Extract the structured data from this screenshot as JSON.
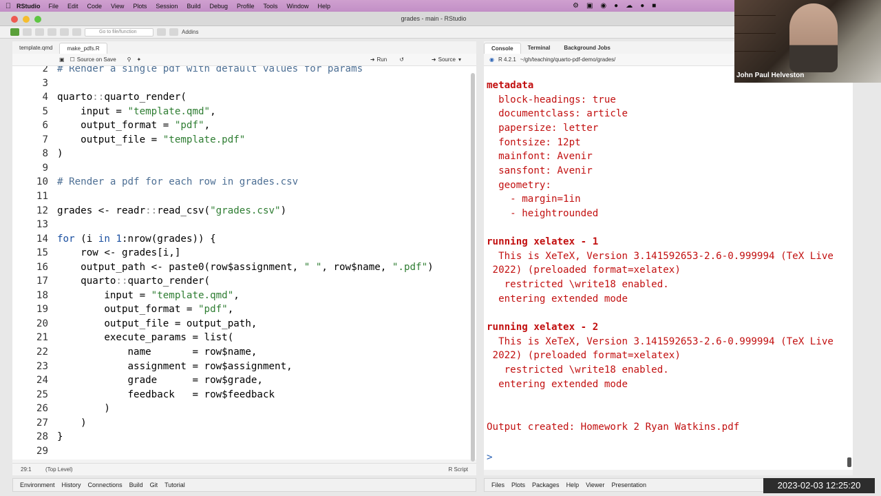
{
  "menubar": {
    "app": "RStudio",
    "items": [
      "File",
      "Edit",
      "Code",
      "View",
      "Plots",
      "Session",
      "Build",
      "Debug",
      "Profile",
      "Tools",
      "Window",
      "Help"
    ]
  },
  "window": {
    "title": "grades - main - RStudio"
  },
  "toolbar": {
    "goto_placeholder": "Go to file/function",
    "addins": "Addins"
  },
  "editor": {
    "tabs": [
      "template.qmd",
      "make_pdfs.R"
    ],
    "source_on_save": "Source on Save",
    "run": "Run",
    "source": "Source",
    "status_pos": "29:1",
    "status_scope": "(Top Level)",
    "status_type": "R Script"
  },
  "code_lines": [
    {
      "n": "2",
      "t": "# Render a single pdf with default values for params"
    },
    {
      "n": "3",
      "t": ""
    },
    {
      "n": "4",
      "t": "quarto::quarto_render("
    },
    {
      "n": "5",
      "t": "    input = \"template.qmd\","
    },
    {
      "n": "6",
      "t": "    output_format = \"pdf\","
    },
    {
      "n": "7",
      "t": "    output_file = \"template.pdf\""
    },
    {
      "n": "8",
      "t": ")"
    },
    {
      "n": "9",
      "t": ""
    },
    {
      "n": "10",
      "t": "# Render a pdf for each row in grades.csv"
    },
    {
      "n": "11",
      "t": ""
    },
    {
      "n": "12",
      "t": "grades <- readr::read_csv(\"grades.csv\")"
    },
    {
      "n": "13",
      "t": ""
    },
    {
      "n": "14",
      "t": "for (i in 1:nrow(grades)) {"
    },
    {
      "n": "15",
      "t": "    row <- grades[i,]"
    },
    {
      "n": "16",
      "t": "    output_path <- paste0(row$assignment, \" \", row$name, \".pdf\")"
    },
    {
      "n": "17",
      "t": "    quarto::quarto_render("
    },
    {
      "n": "18",
      "t": "        input = \"template.qmd\","
    },
    {
      "n": "19",
      "t": "        output_format = \"pdf\","
    },
    {
      "n": "20",
      "t": "        output_file = output_path,"
    },
    {
      "n": "21",
      "t": "        execute_params = list("
    },
    {
      "n": "22",
      "t": "            name       = row$name,"
    },
    {
      "n": "23",
      "t": "            assignment = row$assignment,"
    },
    {
      "n": "24",
      "t": "            grade      = row$grade,"
    },
    {
      "n": "25",
      "t": "            feedback   = row$feedback"
    },
    {
      "n": "26",
      "t": "        )"
    },
    {
      "n": "27",
      "t": "    )"
    },
    {
      "n": "28",
      "t": "}"
    },
    {
      "n": "29",
      "t": ""
    }
  ],
  "console": {
    "tabs": [
      "Console",
      "Terminal",
      "Background Jobs"
    ],
    "r_version": "R 4.2.1",
    "path": "~/gh/teaching/quarto-pdf-demo/grades/",
    "lines": [
      {
        "t": "metadata",
        "b": true
      },
      {
        "t": "  block-headings: true",
        "b": false
      },
      {
        "t": "  documentclass: article",
        "b": false
      },
      {
        "t": "  papersize: letter",
        "b": false
      },
      {
        "t": "  fontsize: 12pt",
        "b": false
      },
      {
        "t": "  mainfont: Avenir",
        "b": false
      },
      {
        "t": "  sansfont: Avenir",
        "b": false
      },
      {
        "t": "  geometry:",
        "b": false
      },
      {
        "t": "    - margin=1in",
        "b": false
      },
      {
        "t": "    - heightrounded",
        "b": false
      },
      {
        "t": "",
        "b": false
      },
      {
        "t": "running xelatex - 1",
        "b": true
      },
      {
        "t": "  This is XeTeX, Version 3.141592653-2.6-0.999994 (TeX Live",
        "b": false
      },
      {
        "t": " 2022) (preloaded format=xelatex)",
        "b": false
      },
      {
        "t": "   restricted \\write18 enabled.",
        "b": false
      },
      {
        "t": "  entering extended mode",
        "b": false
      },
      {
        "t": "",
        "b": false
      },
      {
        "t": "running xelatex - 2",
        "b": true
      },
      {
        "t": "  This is XeTeX, Version 3.141592653-2.6-0.999994 (TeX Live",
        "b": false
      },
      {
        "t": " 2022) (preloaded format=xelatex)",
        "b": false
      },
      {
        "t": "   restricted \\write18 enabled.",
        "b": false
      },
      {
        "t": "  entering extended mode",
        "b": false
      },
      {
        "t": "",
        "b": false
      },
      {
        "t": "",
        "b": false
      },
      {
        "t": "Output created: Homework 2 Ryan Watkins.pdf",
        "b": false
      }
    ],
    "prompt": ">"
  },
  "bottom_left_tabs": [
    "Environment",
    "History",
    "Connections",
    "Build",
    "Git",
    "Tutorial"
  ],
  "bottom_right_tabs": [
    "Files",
    "Plots",
    "Packages",
    "Help",
    "Viewer",
    "Presentation"
  ],
  "video": {
    "name": "John Paul Helveston"
  },
  "timestamp": "2023-02-03  12:25:20"
}
